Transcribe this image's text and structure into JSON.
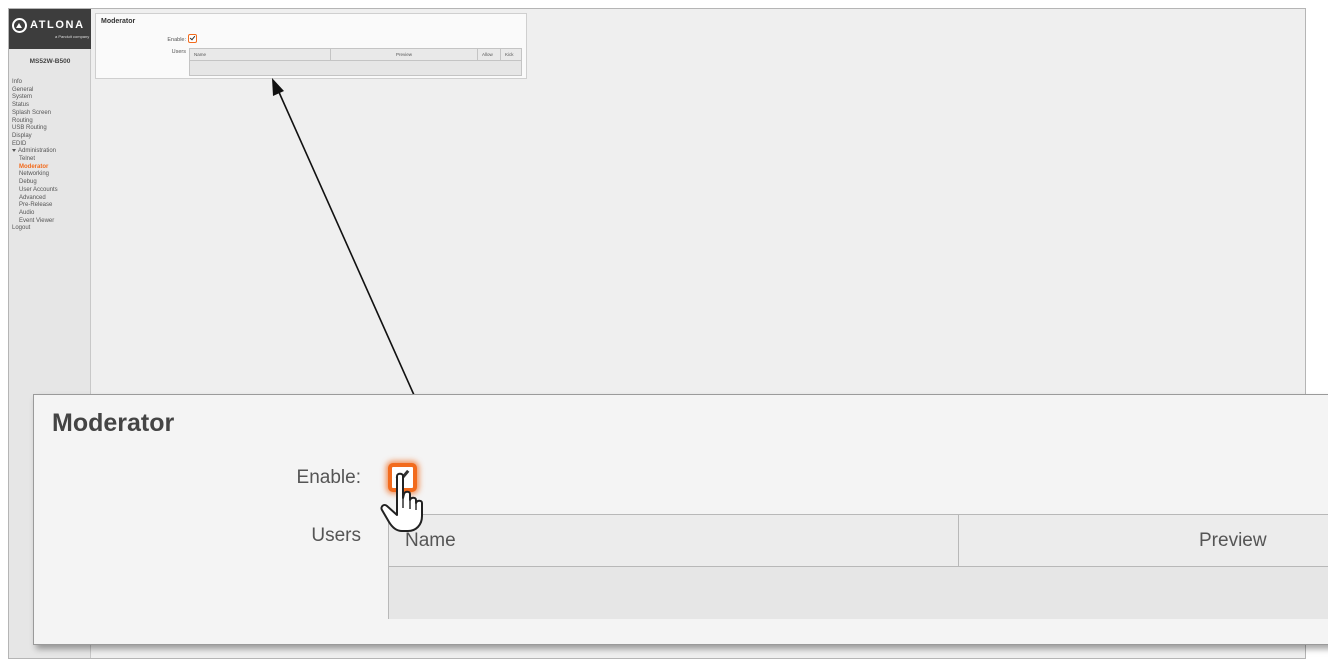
{
  "brand": {
    "logo_text": "ATLONA",
    "logo_sub": "a Panduit company"
  },
  "sidebar": {
    "device_name": "MS52W-B500",
    "items": [
      {
        "label": "Info"
      },
      {
        "label": "General"
      },
      {
        "label": "System"
      },
      {
        "label": "Status"
      },
      {
        "label": "Splash Screen"
      },
      {
        "label": "Routing"
      },
      {
        "label": "USB Routing"
      },
      {
        "label": "Display"
      },
      {
        "label": "EDID"
      },
      {
        "label": "Administration"
      },
      {
        "label": "Telnet"
      },
      {
        "label": "Moderator"
      },
      {
        "label": "Networking"
      },
      {
        "label": "Debug"
      },
      {
        "label": "User Accounts"
      },
      {
        "label": "Advanced"
      },
      {
        "label": "Pre-Release"
      },
      {
        "label": "Audio"
      },
      {
        "label": "Event Viewer"
      },
      {
        "label": "Logout"
      }
    ],
    "active_item": "Moderator",
    "accent_color": "#f26b1d"
  },
  "panel": {
    "title": "Moderator",
    "enable_label": "Enable:",
    "enable_checked": true,
    "users_label": "Users",
    "columns": [
      "Name",
      "Preview",
      "Allow",
      "Kick"
    ],
    "rows": []
  },
  "zoom": {
    "title": "Moderator",
    "enable_label": "Enable:",
    "users_label": "Users",
    "columns": [
      "Name",
      "Preview"
    ]
  },
  "icons": {
    "logo": "atlona-logo-icon",
    "check": "checkbox-checked-icon",
    "pointer": "hand-pointer-icon"
  }
}
